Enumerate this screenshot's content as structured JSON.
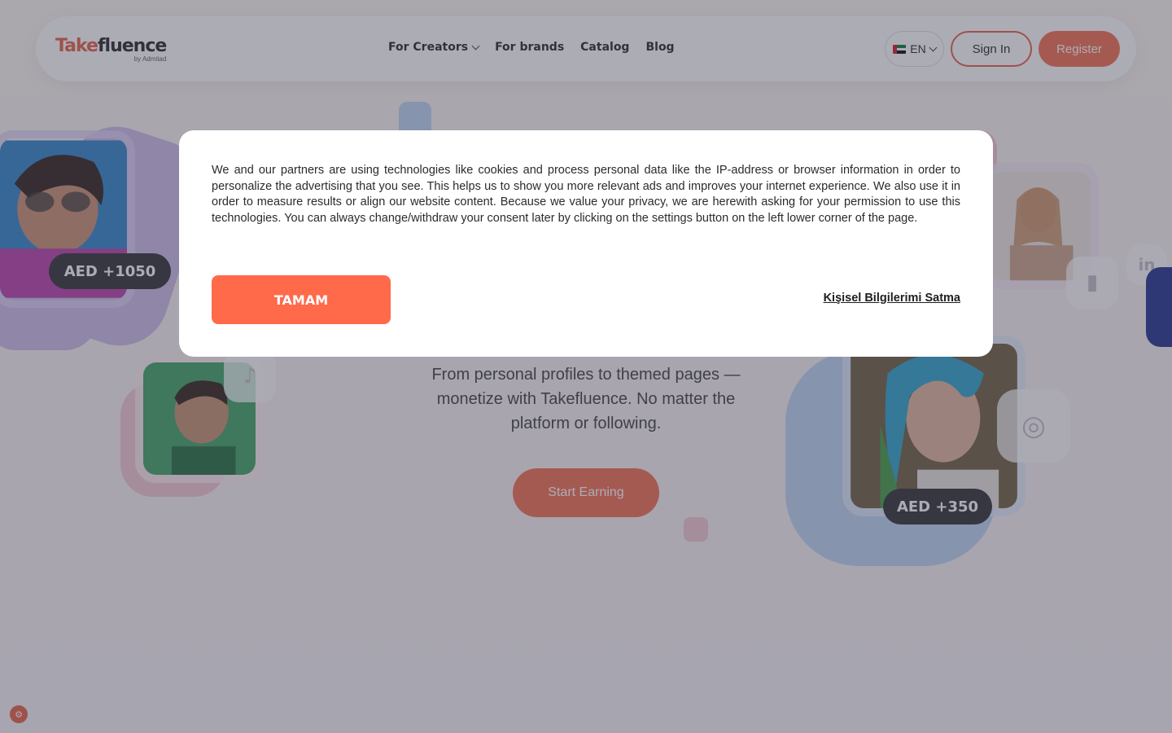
{
  "header": {
    "logo_take": "Take",
    "logo_fluence": "fluence",
    "logo_by": "by Admitad",
    "nav": [
      {
        "label": "For Creators"
      },
      {
        "label": "For brands"
      },
      {
        "label": "Catalog"
      },
      {
        "label": "Blog"
      }
    ],
    "language": "EN",
    "signin_label": "Sign In",
    "register_label": "Register"
  },
  "hero": {
    "subtitle": "From personal profiles to themed pages — monetize with Takefluence. No matter the platform or following.",
    "cta_label": "Start Earning",
    "badges": [
      "AED +1050",
      "AED +350"
    ]
  },
  "consent": {
    "text": "We and our partners are using technologies like cookies and process personal data like the IP-address or browser information in order to personalize the advertising that you see. This helps us to show you more relevant ads and improves your internet experience. We also use it in order to measure results or align our website content. Because we value your privacy, we are herewith asking for your permission to use this technologies. You can always change/withdraw your consent later by clicking on the settings button on the left lower corner of the page.",
    "accept_label": "TAMAM",
    "do_not_sell_label": "Kişisel Bilgilerimi Satma"
  },
  "colors": {
    "brand": "#f26b4a",
    "accept": "#ff6a4a",
    "overlay": "rgba(70,70,90,0.45)"
  }
}
